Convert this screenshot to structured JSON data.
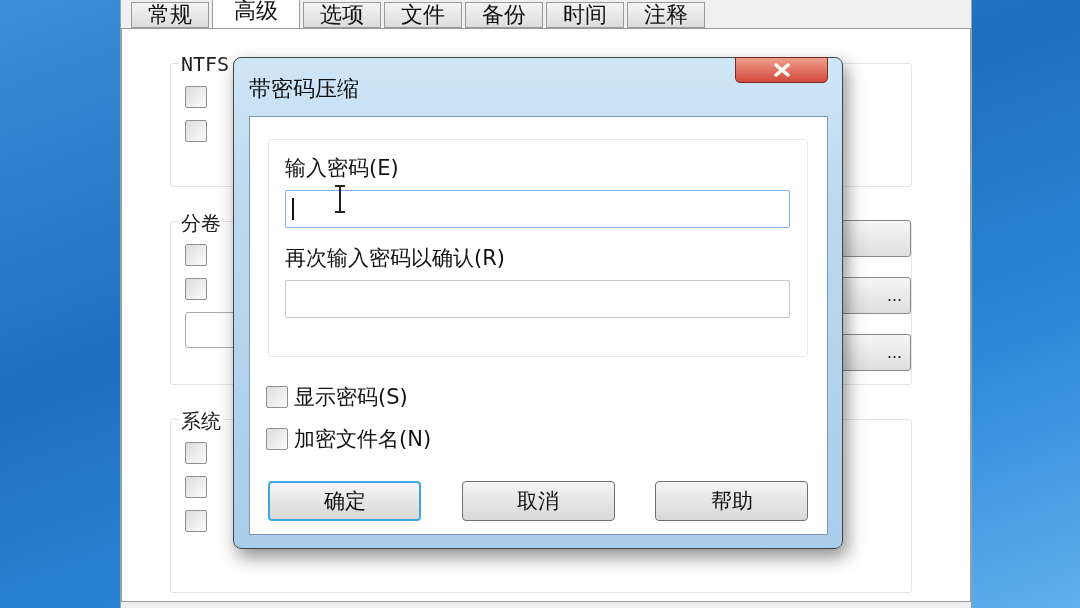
{
  "tabs": [
    {
      "label": "常规",
      "selected": false
    },
    {
      "label": "高级",
      "selected": true
    },
    {
      "label": "选项",
      "selected": false
    },
    {
      "label": "文件",
      "selected": false
    },
    {
      "label": "备份",
      "selected": false
    },
    {
      "label": "时间",
      "selected": false
    },
    {
      "label": "注释",
      "selected": false
    }
  ],
  "groups": [
    {
      "title": "NTFS",
      "checkboxes": [
        {
          "checked": false
        },
        {
          "checked": false
        }
      ]
    },
    {
      "title": "分卷",
      "checkboxes": [
        {
          "checked": false
        },
        {
          "checked": false
        }
      ],
      "side_buttons": [
        {
          "kind": "blank"
        },
        {
          "kind": "browse",
          "label": "..."
        },
        {
          "kind": "browse",
          "label": "..."
        }
      ]
    },
    {
      "title": "系统",
      "checkboxes": [
        {
          "checked": false
        },
        {
          "checked": false
        },
        {
          "checked": false
        }
      ]
    }
  ],
  "dialog": {
    "title": "带密码压缩",
    "fields": [
      {
        "label": "输入密码(E)",
        "focused": true
      },
      {
        "label": "再次输入密码以确认(R)",
        "focused": false
      }
    ],
    "options": [
      {
        "label": "显示密码(S)",
        "checked": false
      },
      {
        "label": "加密文件名(N)",
        "checked": false
      }
    ],
    "buttons": [
      {
        "label": "确定",
        "default": true
      },
      {
        "label": "取消",
        "default": false
      },
      {
        "label": "帮助",
        "default": false
      }
    ]
  }
}
